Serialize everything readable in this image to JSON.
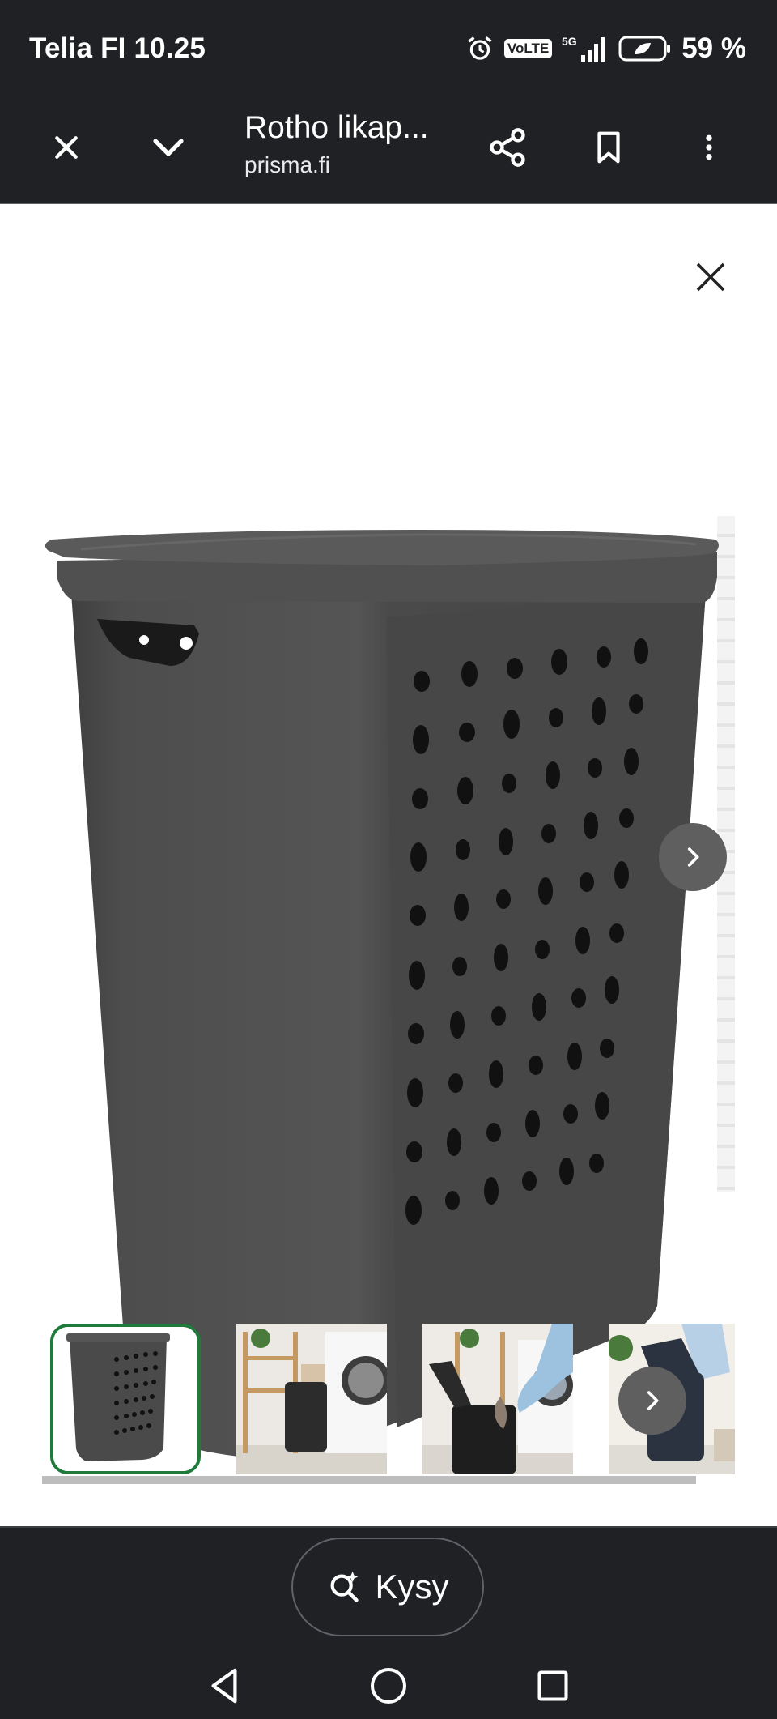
{
  "status_bar": {
    "carrier_time": "Telia FI 10.25",
    "volte": "VoLTE",
    "network": "5G",
    "battery": "59 %"
  },
  "toolbar": {
    "title": "Rotho likap...",
    "domain": "prisma.fi"
  },
  "viewer": {
    "thumbnails": [
      "basket-gray",
      "laundry-room-1",
      "laundry-room-2",
      "laundry-room-3"
    ],
    "selected_index": 0
  },
  "bottom": {
    "ask_label": "Kysy"
  },
  "colors": {
    "chrome": "#202124",
    "selected_thumb_border": "#1f7a3b",
    "basket": "#4a4a4a"
  }
}
